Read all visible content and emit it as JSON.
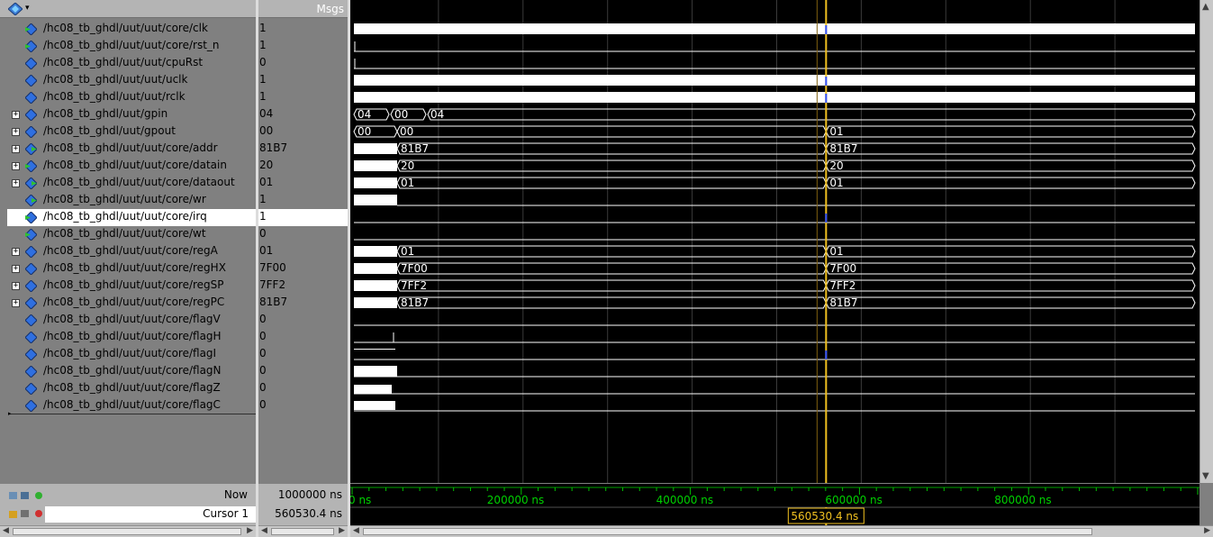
{
  "header": {
    "values_title": "Msgs"
  },
  "signals": [
    {
      "name": "/hc08_tb_ghdl/uut/uut/core/clk",
      "value": "1",
      "expandable": false,
      "kind": "in"
    },
    {
      "name": "/hc08_tb_ghdl/uut/uut/core/rst_n",
      "value": "1",
      "expandable": false,
      "kind": "in"
    },
    {
      "name": "/hc08_tb_ghdl/uut/uut/cpuRst",
      "value": "0",
      "expandable": false,
      "kind": "sig"
    },
    {
      "name": "/hc08_tb_ghdl/uut/uut/uclk",
      "value": "1",
      "expandable": false,
      "kind": "sig"
    },
    {
      "name": "/hc08_tb_ghdl/uut/uut/rclk",
      "value": "1",
      "expandable": false,
      "kind": "sig"
    },
    {
      "name": "/hc08_tb_ghdl/uut/gpin",
      "value": "04",
      "expandable": true,
      "kind": "sig"
    },
    {
      "name": "/hc08_tb_ghdl/uut/gpout",
      "value": "00",
      "expandable": true,
      "kind": "sig"
    },
    {
      "name": "/hc08_tb_ghdl/uut/uut/core/addr",
      "value": "81B7",
      "expandable": true,
      "kind": "out"
    },
    {
      "name": "/hc08_tb_ghdl/uut/uut/core/datain",
      "value": "20",
      "expandable": true,
      "kind": "in"
    },
    {
      "name": "/hc08_tb_ghdl/uut/uut/core/dataout",
      "value": "01",
      "expandable": true,
      "kind": "out"
    },
    {
      "name": "/hc08_tb_ghdl/uut/uut/core/wr",
      "value": "1",
      "expandable": false,
      "kind": "out"
    },
    {
      "name": "/hc08_tb_ghdl/uut/uut/core/irq",
      "value": "1",
      "expandable": false,
      "kind": "in",
      "selected": true
    },
    {
      "name": "/hc08_tb_ghdl/uut/uut/core/wt",
      "value": "0",
      "expandable": false,
      "kind": "in"
    },
    {
      "name": "/hc08_tb_ghdl/uut/uut/core/regA",
      "value": "01",
      "expandable": true,
      "kind": "sig"
    },
    {
      "name": "/hc08_tb_ghdl/uut/uut/core/regHX",
      "value": "7F00",
      "expandable": true,
      "kind": "sig"
    },
    {
      "name": "/hc08_tb_ghdl/uut/uut/core/regSP",
      "value": "7FF2",
      "expandable": true,
      "kind": "sig"
    },
    {
      "name": "/hc08_tb_ghdl/uut/uut/core/regPC",
      "value": "81B7",
      "expandable": true,
      "kind": "sig"
    },
    {
      "name": "/hc08_tb_ghdl/uut/uut/core/flagV",
      "value": "0",
      "expandable": false,
      "kind": "sig"
    },
    {
      "name": "/hc08_tb_ghdl/uut/uut/core/flagH",
      "value": "0",
      "expandable": false,
      "kind": "sig"
    },
    {
      "name": "/hc08_tb_ghdl/uut/uut/core/flagI",
      "value": "0",
      "expandable": false,
      "kind": "sig"
    },
    {
      "name": "/hc08_tb_ghdl/uut/uut/core/flagN",
      "value": "0",
      "expandable": false,
      "kind": "sig"
    },
    {
      "name": "/hc08_tb_ghdl/uut/uut/core/flagZ",
      "value": "0",
      "expandable": false,
      "kind": "sig"
    },
    {
      "name": "/hc08_tb_ghdl/uut/uut/core/flagC",
      "value": "0",
      "expandable": false,
      "kind": "sig"
    }
  ],
  "wave_labels": {
    "gpin": [
      "04",
      "00",
      "04"
    ],
    "gpout": [
      "00",
      "00",
      "01"
    ],
    "addr": [
      "81B7",
      "81B7"
    ],
    "datain": [
      "20",
      "20"
    ],
    "dataout": [
      "01",
      "01"
    ],
    "regA": [
      "01",
      "01"
    ],
    "regHX": [
      "7F00",
      "7F00"
    ],
    "regSP": [
      "7FF2",
      "7FF2"
    ],
    "regPC": [
      "81B7",
      "81B7"
    ]
  },
  "status": {
    "now_label": "Now",
    "now_value": "1000000 ns",
    "cursor_label": "Cursor 1",
    "cursor_value": "560530.4 ns",
    "cursor_flag": "560530.4 ns"
  },
  "timeline": {
    "range_ns": [
      0,
      1000000
    ],
    "cursor_ns": 560530.4,
    "tick_labels": [
      "0 ns",
      "200000 ns",
      "400000 ns",
      "600000 ns",
      "800000 ns"
    ]
  },
  "colors": {
    "cursor": "#f0c020",
    "wave": "#ffffff",
    "timeline_text": "#00d000",
    "panel": "#808080",
    "selected_row": "#ffffff"
  }
}
